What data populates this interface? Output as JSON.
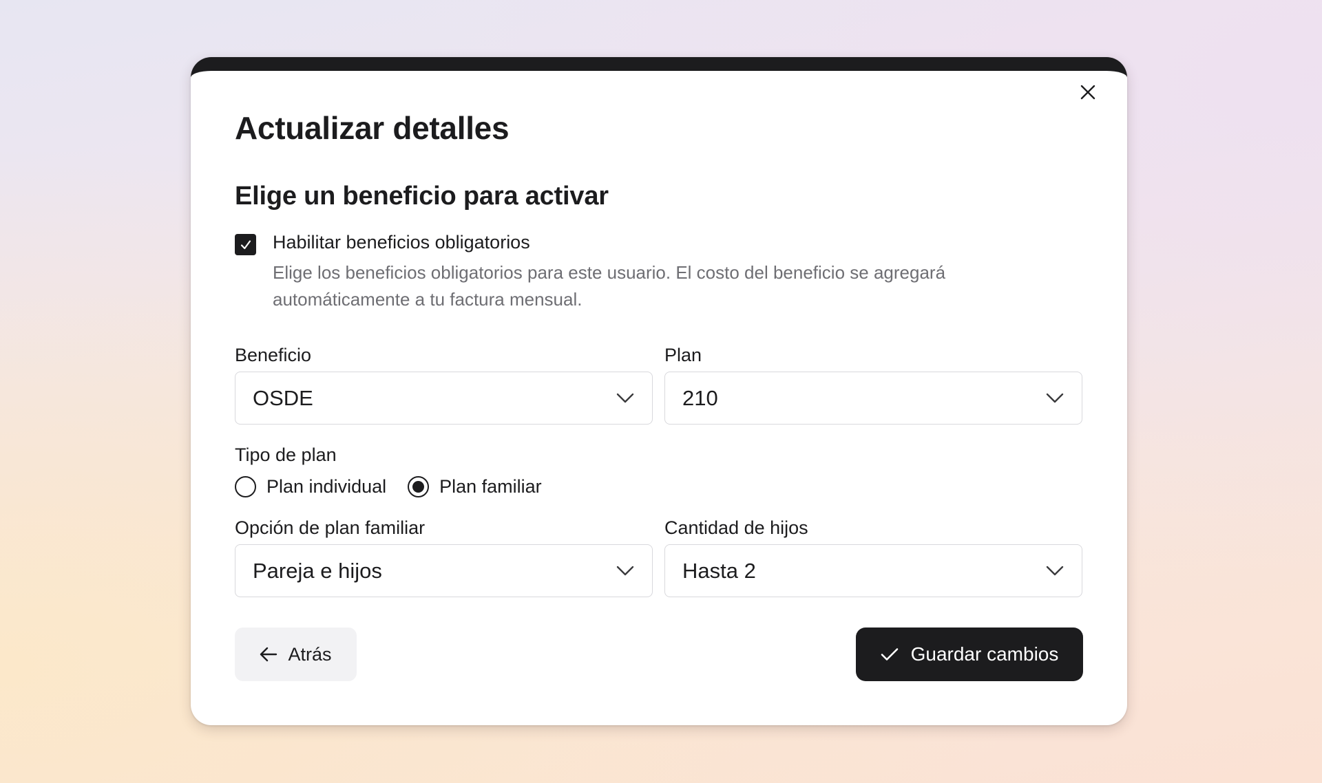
{
  "dialog": {
    "title": "Actualizar detalles",
    "close_icon": "close-icon",
    "section_title": "Elige un beneficio para activar"
  },
  "mandatory_benefits": {
    "checked": true,
    "label": "Habilitar beneficios obligatorios",
    "description": "Elige los beneficios obligatorios para este usuario. El costo del beneficio se agregará automáticamente a tu factura mensual."
  },
  "fields": {
    "benefit": {
      "label": "Beneficio",
      "value": "OSDE"
    },
    "plan": {
      "label": "Plan",
      "value": "210"
    },
    "family_option": {
      "label": "Opción de plan familiar",
      "value": "Pareja e hijos"
    },
    "children_count": {
      "label": "Cantidad de hijos",
      "value": "Hasta 2"
    }
  },
  "plan_type": {
    "label": "Tipo de plan",
    "options": [
      {
        "label": "Plan individual",
        "selected": false
      },
      {
        "label": "Plan familiar",
        "selected": true
      }
    ]
  },
  "actions": {
    "back_label": "Atrás",
    "back_icon": "arrow-left-icon",
    "save_label": "Guardar cambios",
    "save_icon": "check-icon"
  },
  "colors": {
    "primary": "#1c1c1e",
    "muted_text": "#6e6e73",
    "secondary_button": "#f2f2f4",
    "border": "#d8d8dc"
  }
}
